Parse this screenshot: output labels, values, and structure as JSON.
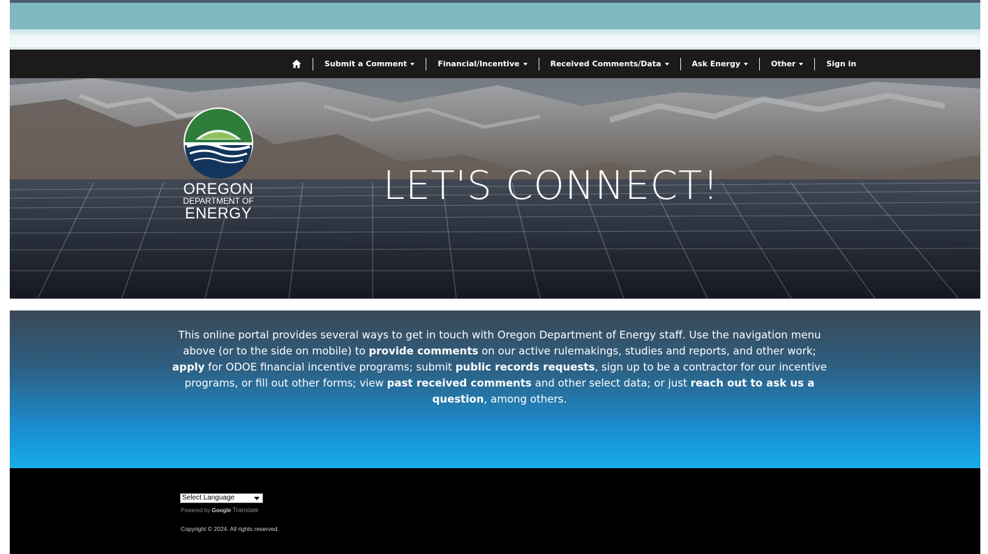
{
  "nav": {
    "items": [
      {
        "label": "Submit a Comment",
        "dropdown": true
      },
      {
        "label": "Financial/Incentive",
        "dropdown": true
      },
      {
        "label": "Received Comments/Data",
        "dropdown": true
      },
      {
        "label": "Ask Energy",
        "dropdown": true
      },
      {
        "label": "Other",
        "dropdown": true
      },
      {
        "label": "Sign in",
        "dropdown": false
      }
    ],
    "home_icon": "home-icon"
  },
  "hero": {
    "title": "LET'S CONNECT!",
    "logo": {
      "line1": "OREGON",
      "line2": "DEPARTMENT OF",
      "line3": "ENERGY",
      "colors": {
        "green": "#2e7d3a",
        "navy": "#13355c"
      }
    }
  },
  "intro": {
    "segments": [
      {
        "text": "This online portal provides several ways to get in touch with Oregon Department of Energy staff. Use the navigation menu above (or to the side on mobile) to ",
        "bold": false
      },
      {
        "text": "provide comments",
        "bold": true
      },
      {
        "text": " on our active rulemakings, studies and reports, and other work; ",
        "bold": false
      },
      {
        "text": "apply",
        "bold": true
      },
      {
        "text": " for ODOE financial incentive programs; submit ",
        "bold": false
      },
      {
        "text": "public records requests",
        "bold": true
      },
      {
        "text": ", sign up to be a contractor for our incentive programs, or fill out other forms; view ",
        "bold": false
      },
      {
        "text": "past received comments",
        "bold": true
      },
      {
        "text": " and other select data; or just ",
        "bold": false
      },
      {
        "text": "reach out to ask us a question",
        "bold": true
      },
      {
        "text": ", among others.",
        "bold": false
      }
    ]
  },
  "footer": {
    "language_select": "Select Language",
    "powered_by": "Powered by",
    "google": "Google",
    "translate": "Translate",
    "copyright": "Copyright © 2024. All rights reserved."
  }
}
